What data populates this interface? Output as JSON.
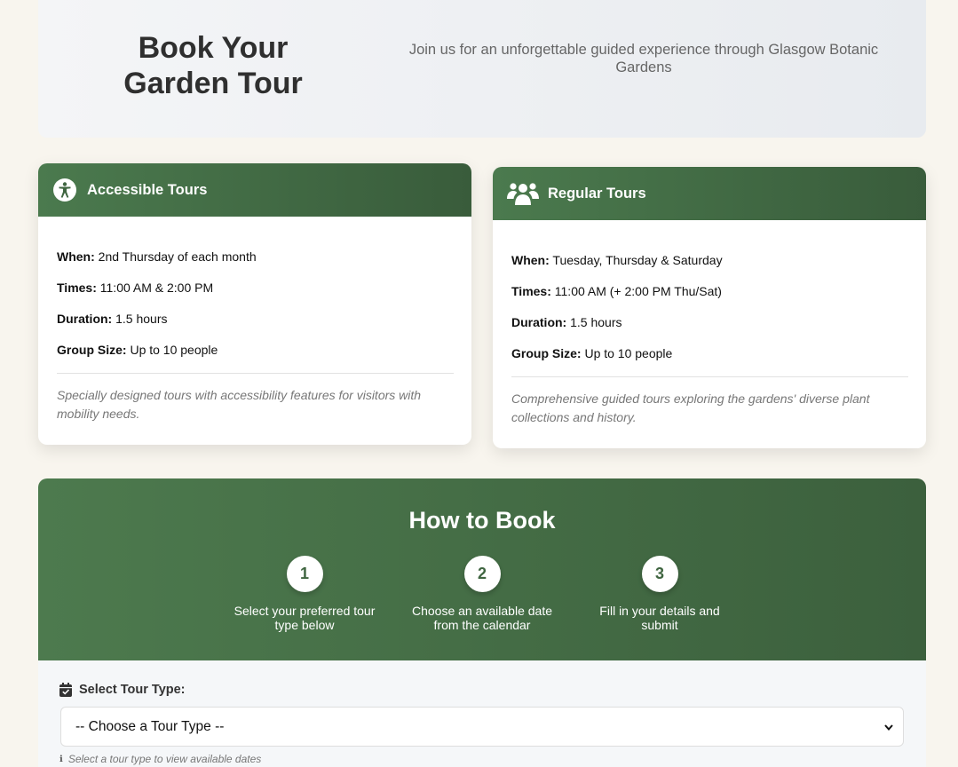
{
  "hero": {
    "title": "Book Your Garden Tour",
    "subtitle": "Join us for an unforgettable guided experience through Glasgow Botanic Gardens"
  },
  "accessible": {
    "icon": "accessibility-icon",
    "title": "Accessible Tours",
    "when_label": "When:",
    "when": "2nd Thursday of each month",
    "times_label": "Times:",
    "times": "11:00 AM & 2:00 PM",
    "duration_label": "Duration:",
    "duration": "1.5 hours",
    "group_label": "Group Size:",
    "group": "Up to 10 people",
    "description": "Specially designed tours with accessibility features for visitors with mobility needs."
  },
  "regular": {
    "icon": "users-icon",
    "title": "Regular Tours",
    "when_label": "When:",
    "when": "Tuesday, Thursday & Saturday",
    "times_label": "Times:",
    "times": "11:00 AM (+ 2:00 PM Thu/Sat)",
    "duration_label": "Duration:",
    "duration": "1.5 hours",
    "group_label": "Group Size:",
    "group": "Up to 10 people",
    "description": "Comprehensive guided tours exploring the gardens' diverse plant collections and history."
  },
  "howto": {
    "title": "How to Book",
    "steps": [
      {
        "num": "1",
        "text": "Select your preferred tour type below"
      },
      {
        "num": "2",
        "text": "Choose an available date from the calendar"
      },
      {
        "num": "3",
        "text": "Fill in your details and submit"
      }
    ]
  },
  "form": {
    "label": "Select Tour Type:",
    "select_value": "-- Choose a Tour Type --",
    "hint": "Select a tour type to view available dates"
  },
  "colors": {
    "primary_green": "#3f6540",
    "background": "#f8f5ee"
  }
}
